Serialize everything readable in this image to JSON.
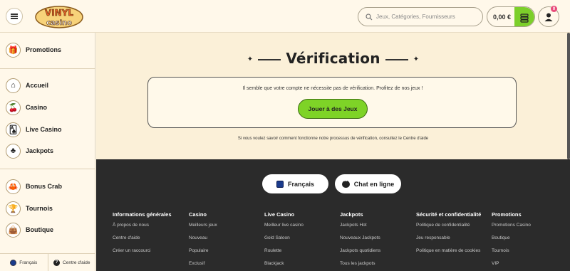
{
  "header": {
    "logo_text_top": "VINYL",
    "logo_text_bottom": "casino",
    "search_placeholder": "Jeux, Catégories, Fournisseurs",
    "balance": "0,00 €",
    "notification_count": "0"
  },
  "sidebar": {
    "items": [
      {
        "label": "Promotions",
        "icon": "gift-icon"
      },
      {
        "label": "Accueil",
        "icon": "home-icon"
      },
      {
        "label": "Casino",
        "icon": "cherries-icon"
      },
      {
        "label": "Live Casino",
        "icon": "cards-icon"
      },
      {
        "label": "Jackpots",
        "icon": "clover-icon"
      },
      {
        "label": "Bonus Crab",
        "icon": "crab-claw-icon"
      },
      {
        "label": "Tournois",
        "icon": "trophy-icon"
      },
      {
        "label": "Boutique",
        "icon": "shop-bag-icon"
      }
    ],
    "footer_language": "Français",
    "footer_help": "Centre d'aide"
  },
  "main": {
    "title": "Vérification",
    "message": "Il semble que votre compte ne nécessite pas de vérification. Profitez de nos jeux !",
    "play_button": "Jouer à des Jeux",
    "help_text": "Si vous voulez savoir comment fonctionne notre processus de vérification, consultez le Centre d'aide"
  },
  "footer": {
    "language_button": "Français",
    "chat_button": "Chat en ligne",
    "columns": [
      {
        "title": "Informations générales",
        "links": [
          "À propos de nous",
          "Centre d'aide",
          "Créer un raccourci"
        ]
      },
      {
        "title": "Casino",
        "links": [
          "Meilleurs jeux",
          "Nouveau",
          "Populaire",
          "Exclusif"
        ]
      },
      {
        "title": "Live Casino",
        "links": [
          "Meilleur live casino",
          "Gold Saloon",
          "Roulette",
          "Blackjack"
        ]
      },
      {
        "title": "Jackpots",
        "links": [
          "Jackpots Hot",
          "Nouveaux Jackpots",
          "Jackpots quotidiens",
          "Tous les jackpots"
        ]
      },
      {
        "title": "Sécurité et confidentialité",
        "links": [
          "Politique de confidentialité",
          "Jeu responsable",
          "Politique en matière de cookies"
        ]
      },
      {
        "title": "Promotions",
        "links": [
          "Promotions Casino",
          "Boutique",
          "Tournois",
          "VIP"
        ]
      }
    ]
  },
  "colors": {
    "accent_green": "#7ed327",
    "footer_bg": "#2b2b2b",
    "page_bg": "#fbf0d8"
  }
}
